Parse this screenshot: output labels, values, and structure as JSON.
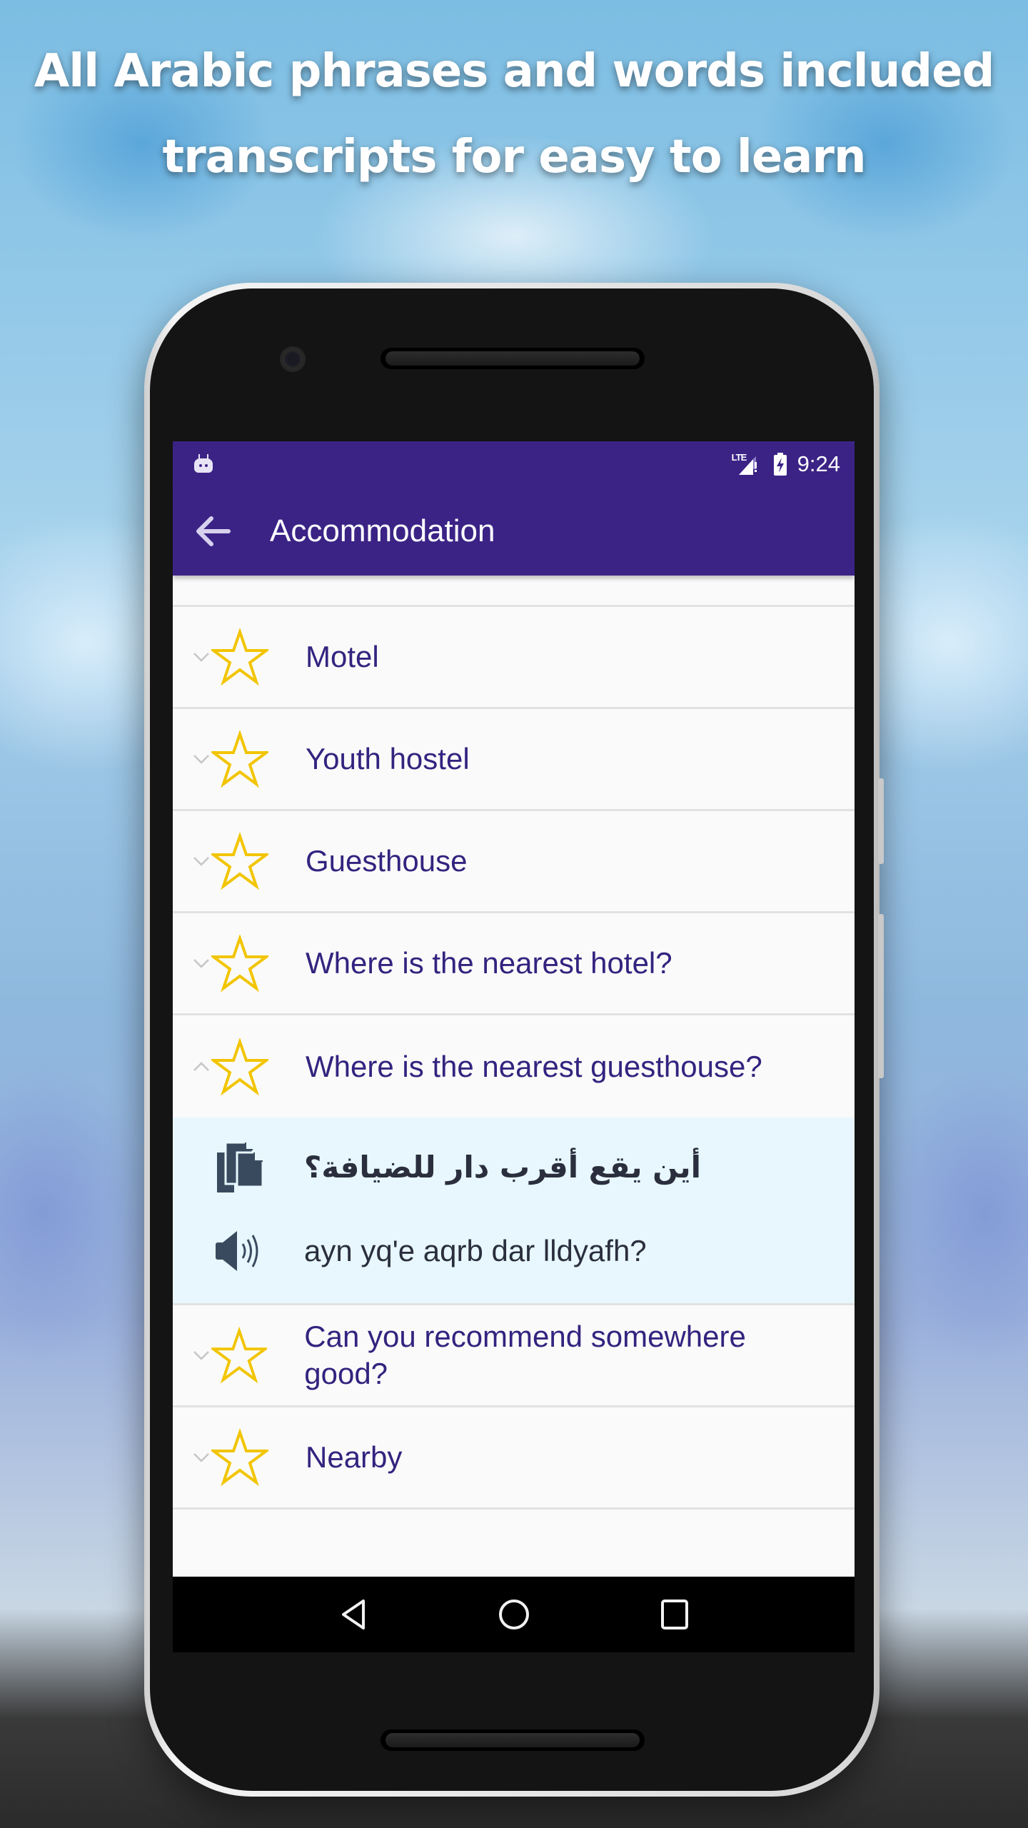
{
  "promo": {
    "headline_line1": "All Arabic phrases and words included",
    "headline_line2": "transcripts for easy to learn"
  },
  "statusbar": {
    "network": "LTE",
    "time": "9:24",
    "icons": [
      "android-notification-icon",
      "lte-signal-icon",
      "battery-charging-icon"
    ]
  },
  "appbar": {
    "back_icon": "arrow-left-icon",
    "title": "Accommodation"
  },
  "colors": {
    "primary": "#3b2386",
    "label_text": "#34237f",
    "star_outline": "#f2c500",
    "detail_bg": "#e7f7fd",
    "divider": "#e2e2e2"
  },
  "phrases": [
    {
      "label": "Motel",
      "favorite": false,
      "expanded": false
    },
    {
      "label": "Youth hostel",
      "favorite": false,
      "expanded": false
    },
    {
      "label": "Guesthouse",
      "favorite": false,
      "expanded": false
    },
    {
      "label": "Where is the nearest hotel?",
      "favorite": false,
      "expanded": false
    },
    {
      "label": "Where is the nearest guesthouse?",
      "favorite": false,
      "expanded": true,
      "arabic": "أين يقع أقرب دار للضيافة؟",
      "transliteration": "ayn yq'e aqrb dar lldyafh?",
      "copy_icon": "copy-icon",
      "audio_icon": "speaker-icon"
    },
    {
      "label": "Can you recommend somewhere good?",
      "favorite": false,
      "expanded": false
    },
    {
      "label": "Nearby",
      "favorite": false,
      "expanded": false
    }
  ],
  "navbar": {
    "buttons": [
      "back-triangle-icon",
      "home-circle-icon",
      "recents-square-icon"
    ]
  }
}
